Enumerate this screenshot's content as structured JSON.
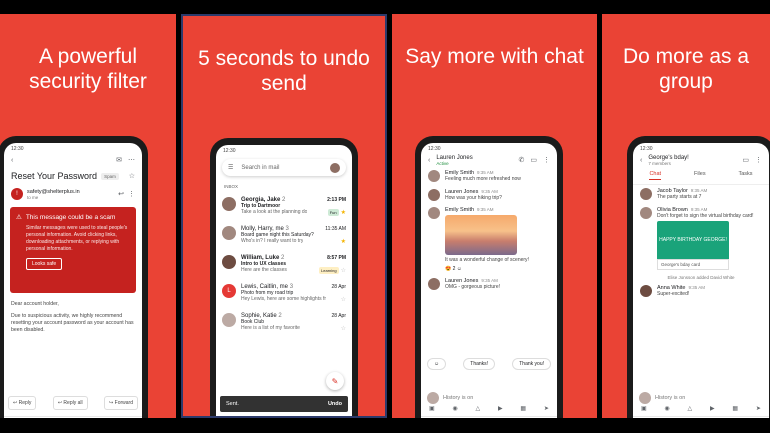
{
  "panels": [
    {
      "headline": "A powerful security filter"
    },
    {
      "headline": "5 seconds to undo send"
    },
    {
      "headline": "Say more with chat"
    },
    {
      "headline": "Do more as a group"
    }
  ],
  "status_time": "12:30",
  "security": {
    "subject": "Reset Your Password",
    "spam_tag": "Spam",
    "sender": "safety@shelterplus.in",
    "recipient": "to me",
    "warning_title": "This message could be a scam",
    "warning_body": "Similar messages were used to steal people's personal information. Avoid clicking links, downloading attachments, or replying with personal information.",
    "looks_safe": "Looks safe",
    "greeting": "Dear account holder,",
    "body": "Due to suspicious activity, we highly recommend resetting your account password as your account has been disabled.",
    "reply": "Reply",
    "reply_all": "Reply all",
    "forward": "Forward"
  },
  "inbox": {
    "search_placeholder": "Search in mail",
    "label": "INBOX",
    "emails": [
      {
        "from": "Georgia, Jake",
        "count": "2",
        "time": "2:13 PM",
        "subject": "Trip to Dartmoor",
        "snippet": "Take a look at the planning do",
        "tag": "Fun",
        "starred": true,
        "bold": true,
        "avatar_color": "#8d6e63"
      },
      {
        "from": "Molly, Harry, me",
        "count": "3",
        "time": "11:35 AM",
        "subject": "Board game night this Saturday?",
        "snippet": "Who's in? I really want to try",
        "tag": "",
        "starred": true,
        "bold": false,
        "avatar_color": "#a1887f"
      },
      {
        "from": "William, Luke",
        "count": "2",
        "time": "8:57 PM",
        "subject": "Intro to UX classes",
        "snippet": "Here are the classes",
        "tag": "Learning",
        "starred": false,
        "bold": true,
        "avatar_color": "#6d4c41"
      },
      {
        "from": "Lewis, Caitlin, me",
        "count": "3",
        "time": "28 Apr",
        "subject": "Photo from my road trip",
        "snippet": "Hey Lewis, here are some highlights fr",
        "tag": "",
        "starred": false,
        "bold": false,
        "avatar_color": "#e53935",
        "initial": "L"
      },
      {
        "from": "Sophie, Katie",
        "count": "2",
        "time": "28 Apr",
        "subject": "Book Club",
        "snippet": "Here is a list of my favorite",
        "tag": "",
        "starred": false,
        "bold": false,
        "avatar_color": "#bcaaa4"
      }
    ],
    "snackbar_text": "Sent.",
    "snackbar_action": "Undo"
  },
  "chat": {
    "contact": "Lauren Jones",
    "contact_status": "Active",
    "messages": [
      {
        "name": "Emily Smith",
        "time": "9:35 AM",
        "text": "Feeling much more refreshed now"
      },
      {
        "name": "Lauren Jones",
        "time": "9:35 AM",
        "text": "How was your hiking trip?"
      },
      {
        "name": "Emily Smith",
        "time": "9:35 AM",
        "text": "It was a wonderful change of scenery!"
      },
      {
        "name": "Lauren Jones",
        "time": "9:35 AM",
        "text": "OMG - gorgeous picture!"
      }
    ],
    "reactions": "2",
    "smart_replies": [
      "Thanks!",
      "Thank you!"
    ],
    "compose_placeholder": "History is on"
  },
  "group": {
    "title": "George's bday!",
    "members": "7 members",
    "tabs": [
      "Chat",
      "Files",
      "Tasks"
    ],
    "messages": [
      {
        "name": "Jacob Taylor",
        "time": "9:35 AM",
        "text": "The party starts at 7"
      },
      {
        "name": "Olivia Brown",
        "time": "9:35 AM",
        "text": "Don't forget to sign the virtual birthday card!"
      },
      {
        "name": "Anna White",
        "time": "9:35 AM",
        "text": "Super-excited!"
      }
    ],
    "card_text": "HAPPY BIRTHDAY GEORGE!",
    "card_label": "George's bday card",
    "system_msg": "Elise Jonsson added David White",
    "compose_placeholder": "History is on"
  }
}
